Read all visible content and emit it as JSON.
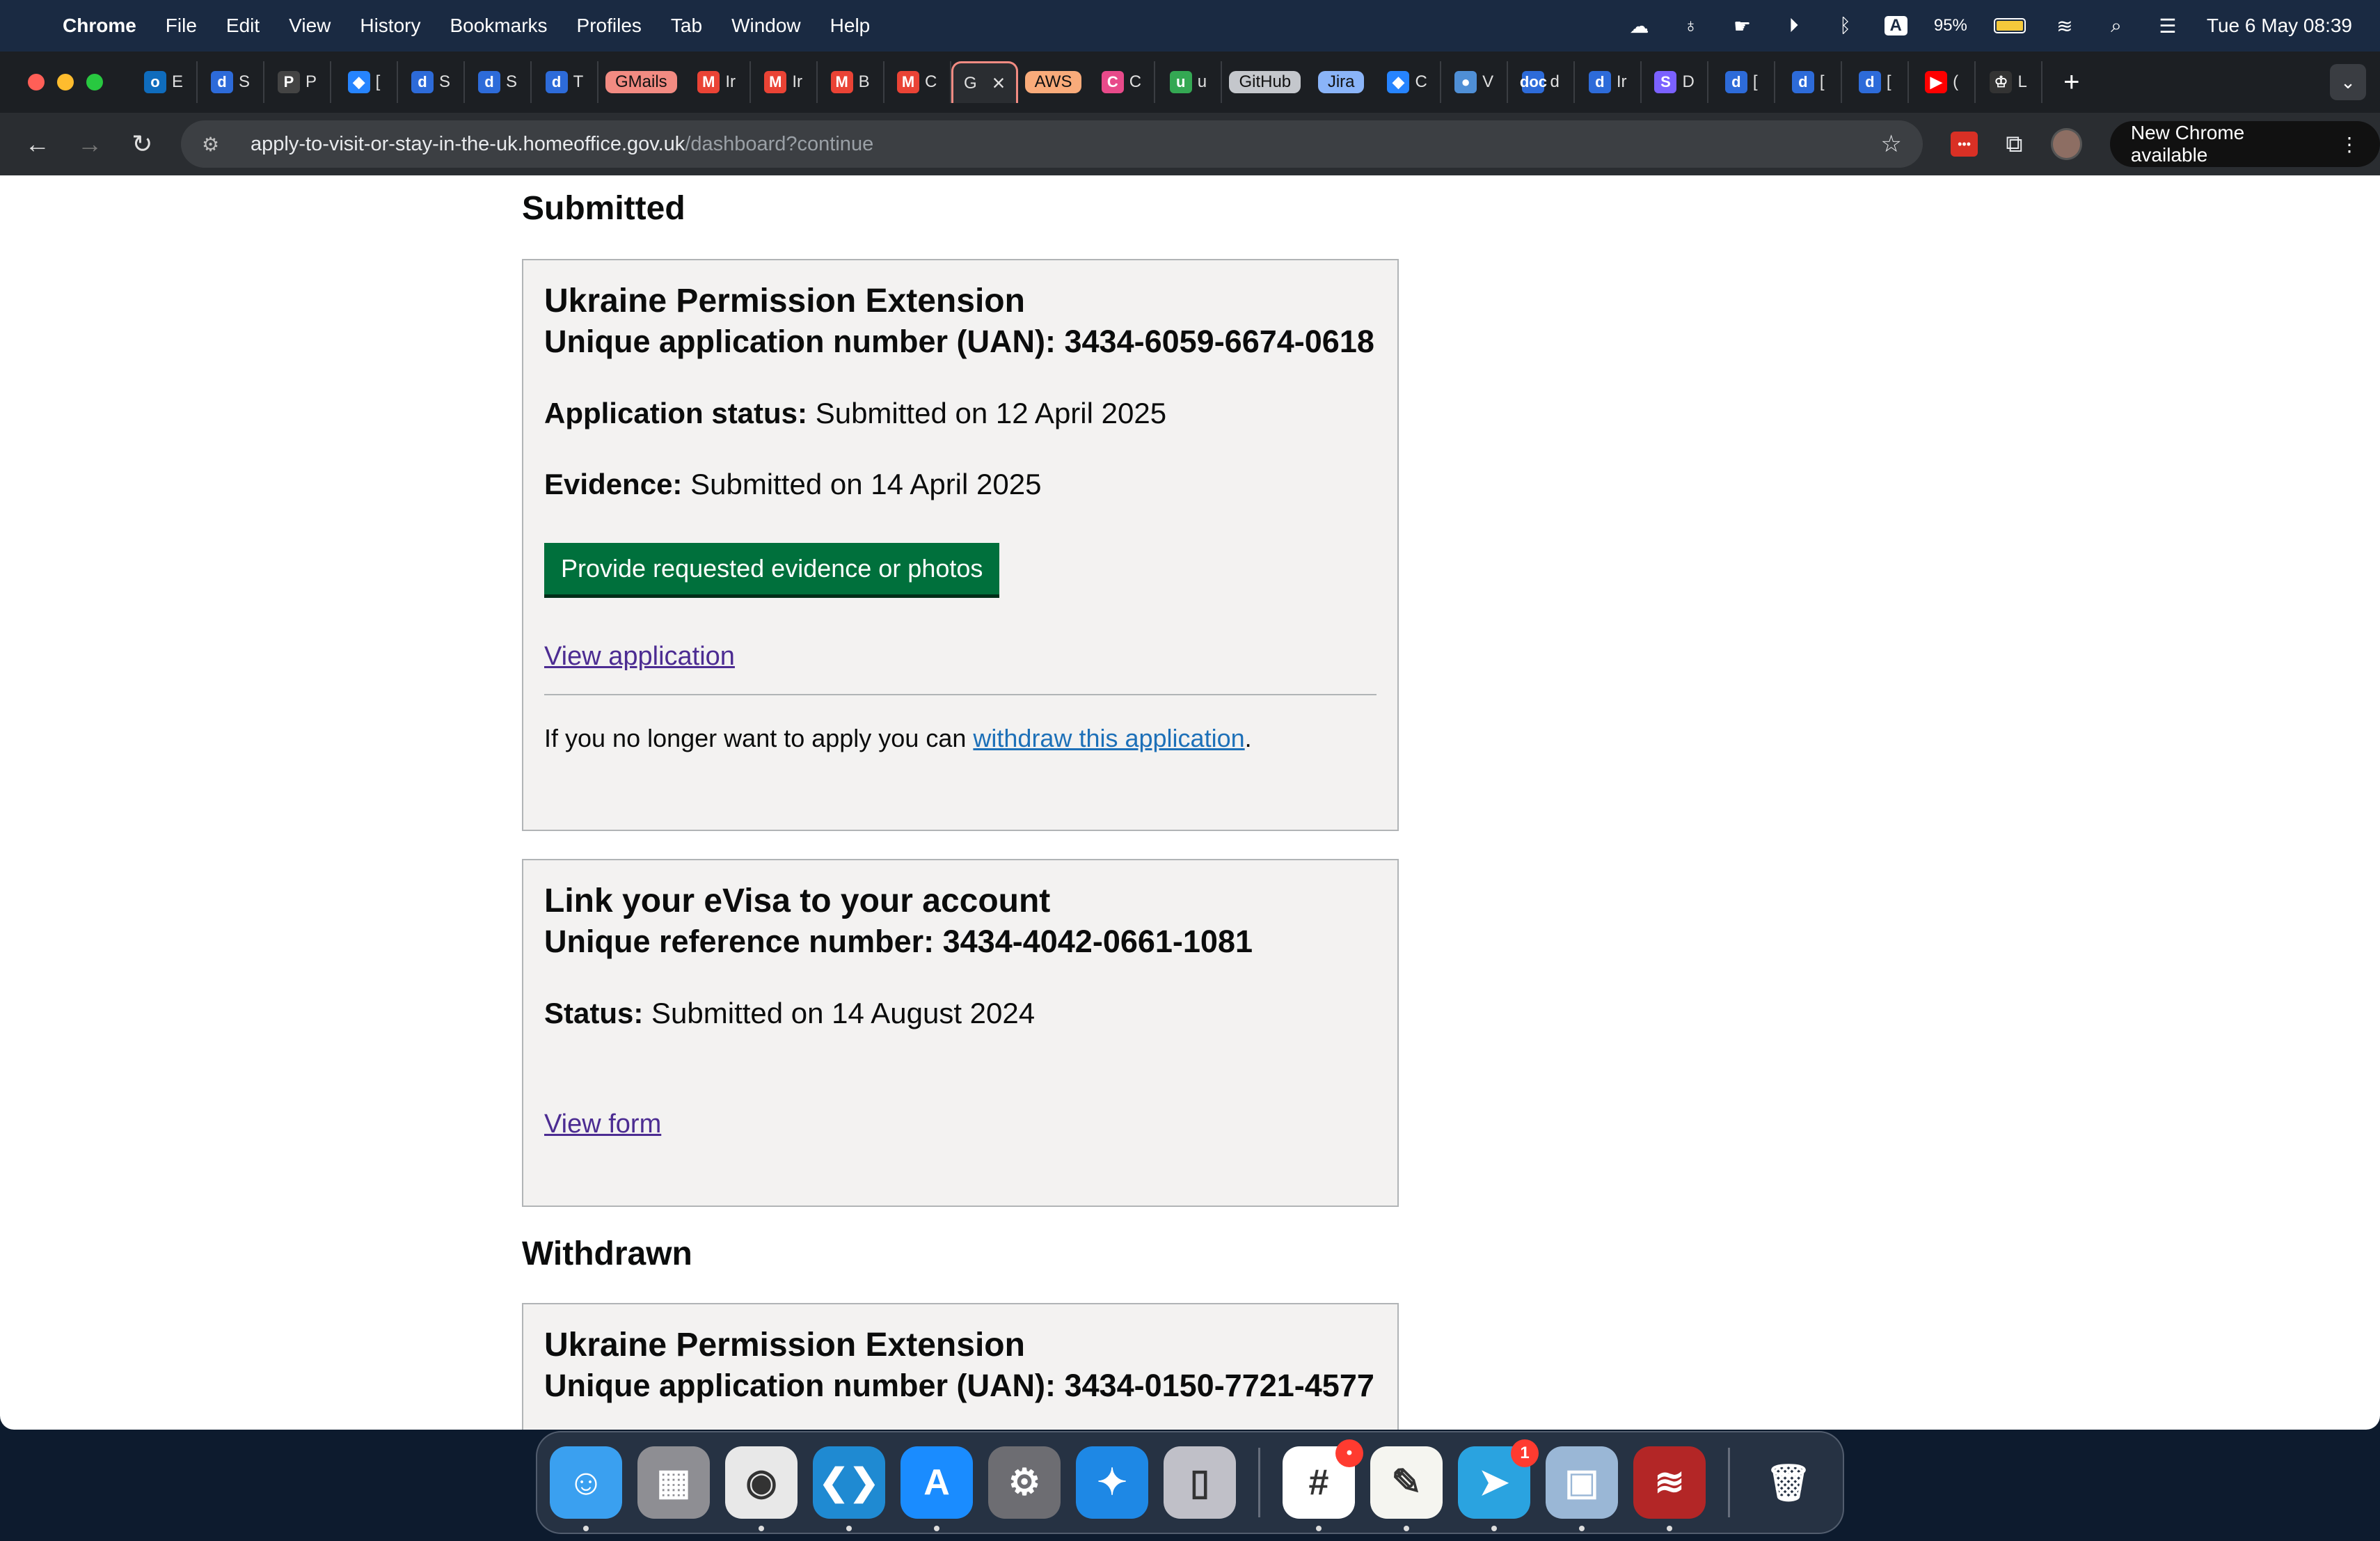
{
  "menubar": {
    "app_name": "Chrome",
    "items": [
      "File",
      "Edit",
      "View",
      "History",
      "Bookmarks",
      "Profiles",
      "Tab",
      "Window",
      "Help"
    ],
    "battery": "95%",
    "input_source": "A",
    "datetime": "Tue 6 May  08:39"
  },
  "tabs": [
    {
      "icon": "outlook-icon",
      "glyph": "o",
      "label": "E",
      "color": "#0f6cbd"
    },
    {
      "icon": "docs-d-icon",
      "glyph": "d",
      "label": "S",
      "color": "#2d6bd9"
    },
    {
      "icon": "p-icon",
      "glyph": "P",
      "label": "P",
      "color": "#444"
    },
    {
      "icon": "jira-icon",
      "glyph": "◆",
      "label": "[",
      "color": "#2684ff"
    },
    {
      "icon": "docs-d-icon",
      "glyph": "d",
      "label": "S",
      "color": "#2d6bd9"
    },
    {
      "icon": "docs-d-icon",
      "glyph": "d",
      "label": "S",
      "color": "#2d6bd9"
    },
    {
      "icon": "docs-d-icon",
      "glyph": "d",
      "label": "T",
      "color": "#2d6bd9"
    },
    {
      "pill": "GMails",
      "pill_color": "#f28b82"
    },
    {
      "icon": "gmail-icon",
      "glyph": "M",
      "label": "Ir",
      "color": "#ea4335"
    },
    {
      "icon": "gmail-icon",
      "glyph": "M",
      "label": "Ir",
      "color": "#ea4335"
    },
    {
      "icon": "gmail-icon",
      "glyph": "M",
      "label": "B",
      "color": "#ea4335"
    },
    {
      "icon": "gmail-icon",
      "glyph": "M",
      "label": "C",
      "color": "#ea4335"
    },
    {
      "active": true,
      "label": "G",
      "close": "×"
    },
    {
      "pill": "AWS",
      "pill_color": "#f9ab7a"
    },
    {
      "icon": "c-icon",
      "glyph": "C",
      "label": "C",
      "color": "#e84a8a"
    },
    {
      "icon": "u-icon",
      "glyph": "u",
      "label": "u",
      "color": "#34a853"
    },
    {
      "pill": "GitHub",
      "pill_color": "#c4c7cc"
    },
    {
      "pill": "Jira",
      "pill_color": "#8ab4f8"
    },
    {
      "icon": "jira-icon",
      "glyph": "◆",
      "label": "C",
      "color": "#2684ff"
    },
    {
      "icon": "globe-icon",
      "glyph": "●",
      "label": "V",
      "color": "#4f8fd6"
    },
    {
      "icon": "doc-icon",
      "glyph": "doc",
      "label": "d",
      "color": "#2d6bd9"
    },
    {
      "icon": "docs-d-icon",
      "glyph": "d",
      "label": "Ir",
      "color": "#2d6bd9"
    },
    {
      "icon": "s-icon",
      "glyph": "S",
      "label": "D",
      "color": "#7b61ff"
    },
    {
      "icon": "docs-d-icon",
      "glyph": "d",
      "label": "[",
      "color": "#2d6bd9"
    },
    {
      "icon": "docs-d-icon",
      "glyph": "d",
      "label": "[",
      "color": "#2d6bd9"
    },
    {
      "icon": "docs-d-icon",
      "glyph": "d",
      "label": "[",
      "color": "#2d6bd9"
    },
    {
      "icon": "youtube-icon",
      "glyph": "▶",
      "label": "(",
      "color": "#ff0000"
    },
    {
      "icon": "crown-icon",
      "glyph": "♔",
      "label": "L",
      "color": "#333"
    }
  ],
  "toolbar": {
    "url_host": "apply-to-visit-or-stay-in-the-uk.homeoffice.gov.uk",
    "url_path": "/dashboard?continue",
    "update_label": "New Chrome available"
  },
  "page": {
    "submitted_heading": "Submitted",
    "card1": {
      "title": "Ukraine Permission Extension",
      "uan": "Unique application number (UAN): 3434-6059-6674-0618",
      "status_label": "Application status:",
      "status_value": " Submitted on 12 April 2025",
      "evidence_label": "Evidence:",
      "evidence_value": " Submitted on 14 April 2025",
      "button": "Provide requested evidence or photos",
      "view_link": "View application",
      "withdraw_prefix": "If you no longer want to apply you can ",
      "withdraw_link": "withdraw this application",
      "withdraw_suffix": "."
    },
    "card2": {
      "title": "Link your eVisa to your account",
      "ref": "Unique reference number: 3434-4042-0661-1081",
      "status_label": "Status:",
      "status_value": " Submitted on 14 August 2024",
      "view_link": "View form"
    },
    "withdrawn_heading": "Withdrawn",
    "card3": {
      "title": "Ukraine Permission Extension",
      "uan": "Unique application number (UAN): 3434-0150-7721-4577"
    }
  },
  "dock": [
    {
      "name": "finder-icon",
      "glyph": "☺",
      "bg": "#3aa0f0",
      "dot": true
    },
    {
      "name": "launchpad-icon",
      "glyph": "▦",
      "bg": "#8e8e93"
    },
    {
      "name": "chrome-icon",
      "glyph": "◉",
      "bg": "#e8e8e8",
      "dot": true
    },
    {
      "name": "vscode-icon",
      "glyph": "❮❯",
      "bg": "#1f8ad2",
      "dot": true
    },
    {
      "name": "app-store-icon",
      "glyph": "A",
      "bg": "#1a8cff",
      "dot": true
    },
    {
      "name": "system-settings-icon",
      "glyph": "⚙",
      "bg": "#6d6d72"
    },
    {
      "name": "safari-icon",
      "glyph": "✦",
      "bg": "#1e88e5"
    },
    {
      "name": "iphone-mirroring-icon",
      "glyph": "▯",
      "bg": "#c0c0c8"
    },
    {
      "separator": true
    },
    {
      "name": "slack-icon",
      "glyph": "#",
      "bg": "#ffffff",
      "badge": "•",
      "dot": true
    },
    {
      "name": "textedit-icon",
      "glyph": "✎",
      "bg": "#f5f5f0",
      "dot": true
    },
    {
      "name": "telegram-icon",
      "glyph": "➤",
      "bg": "#2aa3e0",
      "badge": "1",
      "dot": true
    },
    {
      "name": "preview-icon",
      "glyph": "▣",
      "bg": "#9ab7d6",
      "dot": true
    },
    {
      "name": "database-icon",
      "glyph": "≋",
      "bg": "#b32626",
      "dot": true
    },
    {
      "separator": true
    },
    {
      "name": "trash-icon",
      "glyph": "🗑",
      "bg": "transparent"
    }
  ]
}
